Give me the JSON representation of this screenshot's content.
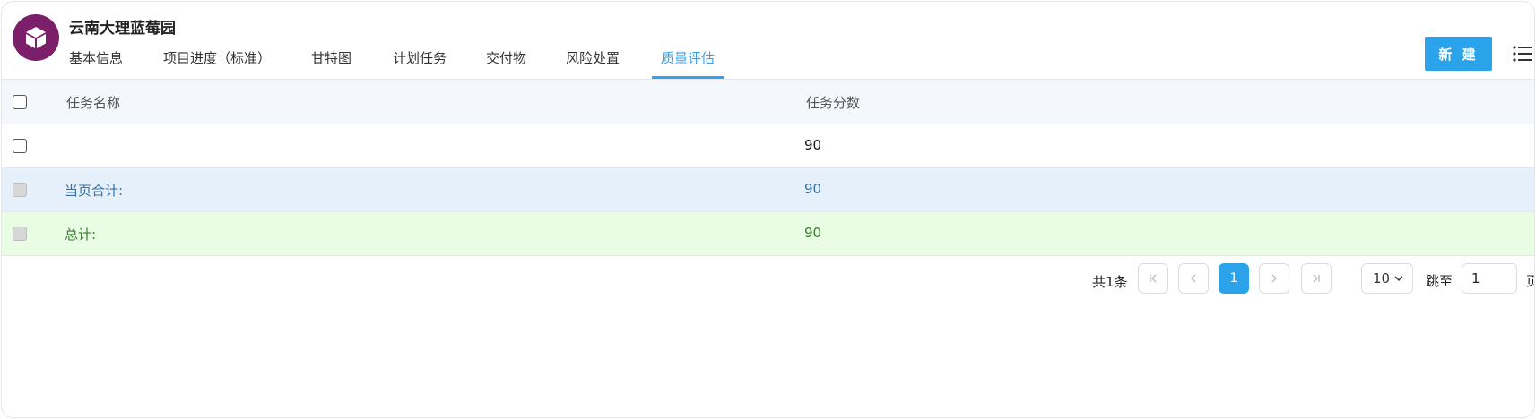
{
  "project": {
    "title": "云南大理蓝莓园"
  },
  "tabs": [
    {
      "label": "基本信息"
    },
    {
      "label": "项目进度（标准）"
    },
    {
      "label": "甘特图"
    },
    {
      "label": "计划任务"
    },
    {
      "label": "交付物"
    },
    {
      "label": "风险处置"
    },
    {
      "label": "质量评估",
      "active": true
    }
  ],
  "toolbar": {
    "new_label": "新 建"
  },
  "table": {
    "columns": [
      "任务名称",
      "任务分数"
    ],
    "rows": [
      {
        "name": "",
        "score": "90"
      }
    ],
    "page_total": {
      "label": "当页合计:",
      "score": "90"
    },
    "grand_total": {
      "label": "总计:",
      "score": "90"
    }
  },
  "pagination": {
    "total_text": "共1条",
    "current_page": "1",
    "page_size": "10",
    "jump_label": "跳至",
    "jump_value": "1",
    "page_suffix": "页"
  },
  "colors": {
    "accent": "#2aa3ea",
    "logo_bg": "#7b1f6a",
    "page_total_bg": "#e6f0fb",
    "grand_total_bg": "#e8fde4"
  }
}
